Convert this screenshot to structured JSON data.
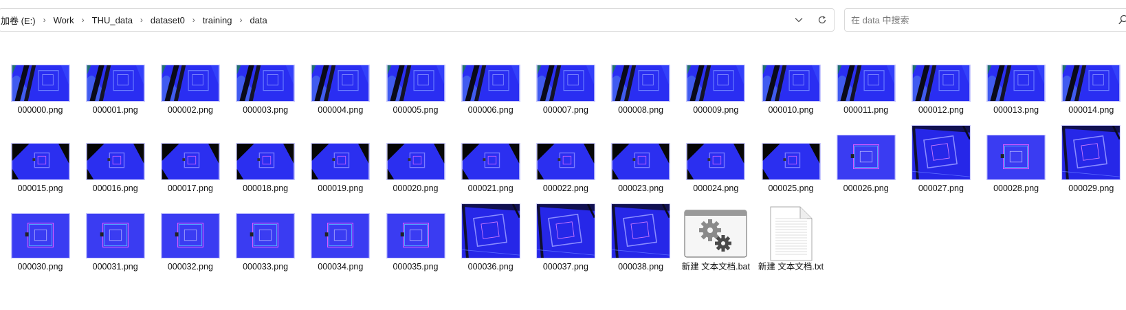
{
  "breadcrumb": {
    "items": [
      "加卷 (E:)",
      "Work",
      "THU_data",
      "dataset0",
      "training",
      "data"
    ]
  },
  "address_bar": {
    "dropdown_icon": "chevron-down-icon",
    "refresh_icon": "refresh-icon"
  },
  "search": {
    "placeholder": "在 data 中搜索",
    "icon": "search-icon"
  },
  "files": [
    {
      "name": "000000.png",
      "style": "a"
    },
    {
      "name": "000001.png",
      "style": "a"
    },
    {
      "name": "000002.png",
      "style": "a"
    },
    {
      "name": "000003.png",
      "style": "a"
    },
    {
      "name": "000004.png",
      "style": "a"
    },
    {
      "name": "000005.png",
      "style": "a"
    },
    {
      "name": "000006.png",
      "style": "a"
    },
    {
      "name": "000007.png",
      "style": "a"
    },
    {
      "name": "000008.png",
      "style": "a"
    },
    {
      "name": "000009.png",
      "style": "a"
    },
    {
      "name": "000010.png",
      "style": "a"
    },
    {
      "name": "000011.png",
      "style": "a"
    },
    {
      "name": "000012.png",
      "style": "a"
    },
    {
      "name": "000013.png",
      "style": "a"
    },
    {
      "name": "000014.png",
      "style": "a"
    },
    {
      "name": "000015.png",
      "style": "b"
    },
    {
      "name": "000016.png",
      "style": "b"
    },
    {
      "name": "000017.png",
      "style": "b"
    },
    {
      "name": "000018.png",
      "style": "b"
    },
    {
      "name": "000019.png",
      "style": "b"
    },
    {
      "name": "000020.png",
      "style": "b"
    },
    {
      "name": "000021.png",
      "style": "b"
    },
    {
      "name": "000022.png",
      "style": "b"
    },
    {
      "name": "000023.png",
      "style": "b"
    },
    {
      "name": "000024.png",
      "style": "b"
    },
    {
      "name": "000025.png",
      "style": "b"
    },
    {
      "name": "000026.png",
      "style": "c"
    },
    {
      "name": "000027.png",
      "style": "d"
    },
    {
      "name": "000028.png",
      "style": "c"
    },
    {
      "name": "000029.png",
      "style": "d"
    },
    {
      "name": "000030.png",
      "style": "c"
    },
    {
      "name": "000031.png",
      "style": "c"
    },
    {
      "name": "000032.png",
      "style": "c"
    },
    {
      "name": "000033.png",
      "style": "c"
    },
    {
      "name": "000034.png",
      "style": "c"
    },
    {
      "name": "000035.png",
      "style": "c"
    },
    {
      "name": "000036.png",
      "style": "d"
    },
    {
      "name": "000037.png",
      "style": "d"
    },
    {
      "name": "000038.png",
      "style": "d"
    },
    {
      "name": "新建 文本文档.bat",
      "style": "bat",
      "icon": "batch-file-gear-icon"
    },
    {
      "name": "新建 文本文档.txt",
      "style": "txt",
      "icon": "text-document-icon"
    }
  ]
}
